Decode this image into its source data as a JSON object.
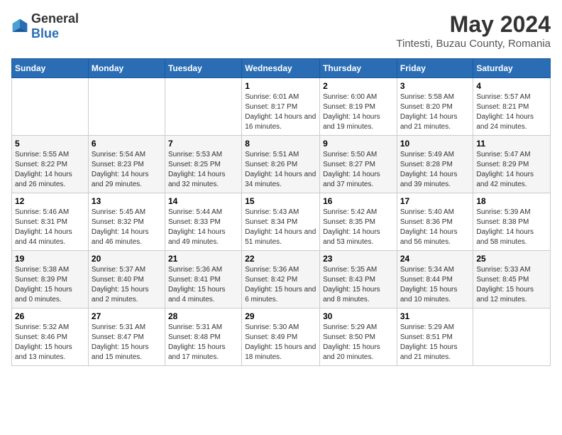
{
  "logo": {
    "general": "General",
    "blue": "Blue"
  },
  "header": {
    "title": "May 2024",
    "subtitle": "Tintesti, Buzau County, Romania"
  },
  "weekdays": [
    "Sunday",
    "Monday",
    "Tuesday",
    "Wednesday",
    "Thursday",
    "Friday",
    "Saturday"
  ],
  "weeks": [
    [
      {
        "day": "",
        "sunrise": "",
        "sunset": "",
        "daylight": ""
      },
      {
        "day": "",
        "sunrise": "",
        "sunset": "",
        "daylight": ""
      },
      {
        "day": "",
        "sunrise": "",
        "sunset": "",
        "daylight": ""
      },
      {
        "day": "1",
        "sunrise": "Sunrise: 6:01 AM",
        "sunset": "Sunset: 8:17 PM",
        "daylight": "Daylight: 14 hours and 16 minutes."
      },
      {
        "day": "2",
        "sunrise": "Sunrise: 6:00 AM",
        "sunset": "Sunset: 8:19 PM",
        "daylight": "Daylight: 14 hours and 19 minutes."
      },
      {
        "day": "3",
        "sunrise": "Sunrise: 5:58 AM",
        "sunset": "Sunset: 8:20 PM",
        "daylight": "Daylight: 14 hours and 21 minutes."
      },
      {
        "day": "4",
        "sunrise": "Sunrise: 5:57 AM",
        "sunset": "Sunset: 8:21 PM",
        "daylight": "Daylight: 14 hours and 24 minutes."
      }
    ],
    [
      {
        "day": "5",
        "sunrise": "Sunrise: 5:55 AM",
        "sunset": "Sunset: 8:22 PM",
        "daylight": "Daylight: 14 hours and 26 minutes."
      },
      {
        "day": "6",
        "sunrise": "Sunrise: 5:54 AM",
        "sunset": "Sunset: 8:23 PM",
        "daylight": "Daylight: 14 hours and 29 minutes."
      },
      {
        "day": "7",
        "sunrise": "Sunrise: 5:53 AM",
        "sunset": "Sunset: 8:25 PM",
        "daylight": "Daylight: 14 hours and 32 minutes."
      },
      {
        "day": "8",
        "sunrise": "Sunrise: 5:51 AM",
        "sunset": "Sunset: 8:26 PM",
        "daylight": "Daylight: 14 hours and 34 minutes."
      },
      {
        "day": "9",
        "sunrise": "Sunrise: 5:50 AM",
        "sunset": "Sunset: 8:27 PM",
        "daylight": "Daylight: 14 hours and 37 minutes."
      },
      {
        "day": "10",
        "sunrise": "Sunrise: 5:49 AM",
        "sunset": "Sunset: 8:28 PM",
        "daylight": "Daylight: 14 hours and 39 minutes."
      },
      {
        "day": "11",
        "sunrise": "Sunrise: 5:47 AM",
        "sunset": "Sunset: 8:29 PM",
        "daylight": "Daylight: 14 hours and 42 minutes."
      }
    ],
    [
      {
        "day": "12",
        "sunrise": "Sunrise: 5:46 AM",
        "sunset": "Sunset: 8:31 PM",
        "daylight": "Daylight: 14 hours and 44 minutes."
      },
      {
        "day": "13",
        "sunrise": "Sunrise: 5:45 AM",
        "sunset": "Sunset: 8:32 PM",
        "daylight": "Daylight: 14 hours and 46 minutes."
      },
      {
        "day": "14",
        "sunrise": "Sunrise: 5:44 AM",
        "sunset": "Sunset: 8:33 PM",
        "daylight": "Daylight: 14 hours and 49 minutes."
      },
      {
        "day": "15",
        "sunrise": "Sunrise: 5:43 AM",
        "sunset": "Sunset: 8:34 PM",
        "daylight": "Daylight: 14 hours and 51 minutes."
      },
      {
        "day": "16",
        "sunrise": "Sunrise: 5:42 AM",
        "sunset": "Sunset: 8:35 PM",
        "daylight": "Daylight: 14 hours and 53 minutes."
      },
      {
        "day": "17",
        "sunrise": "Sunrise: 5:40 AM",
        "sunset": "Sunset: 8:36 PM",
        "daylight": "Daylight: 14 hours and 56 minutes."
      },
      {
        "day": "18",
        "sunrise": "Sunrise: 5:39 AM",
        "sunset": "Sunset: 8:38 PM",
        "daylight": "Daylight: 14 hours and 58 minutes."
      }
    ],
    [
      {
        "day": "19",
        "sunrise": "Sunrise: 5:38 AM",
        "sunset": "Sunset: 8:39 PM",
        "daylight": "Daylight: 15 hours and 0 minutes."
      },
      {
        "day": "20",
        "sunrise": "Sunrise: 5:37 AM",
        "sunset": "Sunset: 8:40 PM",
        "daylight": "Daylight: 15 hours and 2 minutes."
      },
      {
        "day": "21",
        "sunrise": "Sunrise: 5:36 AM",
        "sunset": "Sunset: 8:41 PM",
        "daylight": "Daylight: 15 hours and 4 minutes."
      },
      {
        "day": "22",
        "sunrise": "Sunrise: 5:36 AM",
        "sunset": "Sunset: 8:42 PM",
        "daylight": "Daylight: 15 hours and 6 minutes."
      },
      {
        "day": "23",
        "sunrise": "Sunrise: 5:35 AM",
        "sunset": "Sunset: 8:43 PM",
        "daylight": "Daylight: 15 hours and 8 minutes."
      },
      {
        "day": "24",
        "sunrise": "Sunrise: 5:34 AM",
        "sunset": "Sunset: 8:44 PM",
        "daylight": "Daylight: 15 hours and 10 minutes."
      },
      {
        "day": "25",
        "sunrise": "Sunrise: 5:33 AM",
        "sunset": "Sunset: 8:45 PM",
        "daylight": "Daylight: 15 hours and 12 minutes."
      }
    ],
    [
      {
        "day": "26",
        "sunrise": "Sunrise: 5:32 AM",
        "sunset": "Sunset: 8:46 PM",
        "daylight": "Daylight: 15 hours and 13 minutes."
      },
      {
        "day": "27",
        "sunrise": "Sunrise: 5:31 AM",
        "sunset": "Sunset: 8:47 PM",
        "daylight": "Daylight: 15 hours and 15 minutes."
      },
      {
        "day": "28",
        "sunrise": "Sunrise: 5:31 AM",
        "sunset": "Sunset: 8:48 PM",
        "daylight": "Daylight: 15 hours and 17 minutes."
      },
      {
        "day": "29",
        "sunrise": "Sunrise: 5:30 AM",
        "sunset": "Sunset: 8:49 PM",
        "daylight": "Daylight: 15 hours and 18 minutes."
      },
      {
        "day": "30",
        "sunrise": "Sunrise: 5:29 AM",
        "sunset": "Sunset: 8:50 PM",
        "daylight": "Daylight: 15 hours and 20 minutes."
      },
      {
        "day": "31",
        "sunrise": "Sunrise: 5:29 AM",
        "sunset": "Sunset: 8:51 PM",
        "daylight": "Daylight: 15 hours and 21 minutes."
      },
      {
        "day": "",
        "sunrise": "",
        "sunset": "",
        "daylight": ""
      }
    ]
  ]
}
